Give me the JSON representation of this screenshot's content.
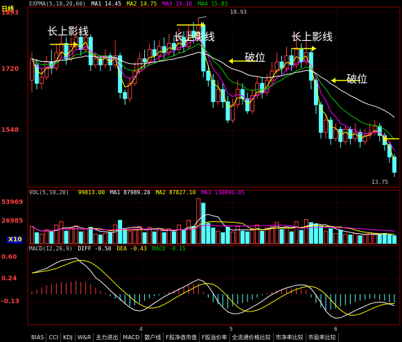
{
  "colors": {
    "up": "#ff3c3c",
    "down": "#54ffff",
    "ma1": "#ffffff",
    "ma2": "#ffff00",
    "ma3": "#ff00ff",
    "ma4": "#00cc00",
    "grid": "#8b0000",
    "axis_text": "#ff4040",
    "highlight": "#ffff00"
  },
  "main_panel": {
    "period": "日线",
    "header": {
      "title": "EXPMA(5,10,20,60)",
      "ma1": "MA1 14.45",
      "ma2": "MA2 14.75",
      "ma3": "MA3 15.16",
      "ma4": "MA4 15.83"
    },
    "y_labels": [
      "1893",
      "1720",
      "1548"
    ],
    "high_label": "18.93",
    "low_label": "13.75",
    "annotations": [
      {
        "text": "长上影线"
      },
      {
        "text": "长上影线"
      },
      {
        "text": "破位"
      },
      {
        "text": "长上影线"
      },
      {
        "text": "破位"
      }
    ]
  },
  "volume_panel": {
    "header": {
      "title": "VOL(5,10,20)",
      "value": "99813.00",
      "ma1": "MA1 87989.20",
      "ma2": "MA2 87827.10",
      "ma3": "MA3 130896.05"
    },
    "y_labels": [
      "53969",
      "26985"
    ],
    "unit_label": "X10"
  },
  "macd_panel": {
    "header": {
      "title": "MACD(12,26,9)",
      "diff": "DIFF -0.50",
      "dea": "DEA -0.43",
      "macd": "MACD -0.15"
    },
    "y_labels": [
      "0.60",
      "0.24",
      "-0.13"
    ]
  },
  "x_ticks": [
    "4",
    "5",
    "6"
  ],
  "tabs": [
    "BIAS",
    "CCI",
    "KDJ",
    "W&R",
    "主力进出",
    "MACD",
    "散户线",
    "F股净值市值",
    "F股溢价率",
    "全流通价格比较",
    "市净率比较",
    "市盈率比较"
  ],
  "chart_data": [
    {
      "type": "candlestick",
      "title": "EXPMA(5,10,20,60)",
      "y_ticks": [
        18.93,
        17.2,
        15.48
      ],
      "ylim": [
        13.5,
        19.2
      ],
      "annotated_high": 18.93,
      "annotated_low": 13.75,
      "candles": [
        [
          16.9,
          17.6,
          17.8,
          16.5
        ],
        [
          17.4,
          16.8,
          17.6,
          16.6
        ],
        [
          16.8,
          17.0,
          17.3,
          16.6
        ],
        [
          17.0,
          17.5,
          17.7,
          16.9
        ],
        [
          17.5,
          17.3,
          17.9,
          17.1
        ],
        [
          17.3,
          17.8,
          18.1,
          17.2
        ],
        [
          17.8,
          18.1,
          18.4,
          17.6
        ],
        [
          18.1,
          17.6,
          18.3,
          17.4
        ],
        [
          17.6,
          18.0,
          18.3,
          17.5
        ],
        [
          18.0,
          18.3,
          18.6,
          17.9
        ],
        [
          18.3,
          17.9,
          18.5,
          17.7
        ],
        [
          17.9,
          18.3,
          18.5,
          17.8
        ],
        [
          18.3,
          17.4,
          18.4,
          17.2
        ],
        [
          17.4,
          17.6,
          17.8,
          17.3
        ],
        [
          17.6,
          17.4,
          17.7,
          17.2
        ],
        [
          17.4,
          17.7,
          17.9,
          17.3
        ],
        [
          17.7,
          17.4,
          17.8,
          17.2
        ],
        [
          17.4,
          17.7,
          18.2,
          17.3
        ],
        [
          17.7,
          16.5,
          17.8,
          16.3
        ],
        [
          16.5,
          16.3,
          16.6,
          16.1
        ],
        [
          16.3,
          16.8,
          17.0,
          16.2
        ],
        [
          16.8,
          17.2,
          17.5,
          16.7
        ],
        [
          17.2,
          17.6,
          17.8,
          17.1
        ],
        [
          17.6,
          17.5,
          17.9,
          17.3
        ],
        [
          17.5,
          17.9,
          18.1,
          17.4
        ],
        [
          17.9,
          17.7,
          18.2,
          17.5
        ],
        [
          17.7,
          18.0,
          18.2,
          17.5
        ],
        [
          18.0,
          17.8,
          18.3,
          17.6
        ],
        [
          17.8,
          18.1,
          18.4,
          17.7
        ],
        [
          18.1,
          17.9,
          18.3,
          17.7
        ],
        [
          17.9,
          18.3,
          18.6,
          17.8
        ],
        [
          18.3,
          18.0,
          18.5,
          17.8
        ],
        [
          18.0,
          18.5,
          18.7,
          17.9
        ],
        [
          18.5,
          18.3,
          18.8,
          18.1
        ],
        [
          18.3,
          18.7,
          18.93,
          18.2
        ],
        [
          18.7,
          17.2,
          18.8,
          17.0
        ],
        [
          17.2,
          16.9,
          17.4,
          16.7
        ],
        [
          16.9,
          16.2,
          17.1,
          16.0
        ],
        [
          16.2,
          16.6,
          16.9,
          16.1
        ],
        [
          16.6,
          16.2,
          16.8,
          16.0
        ],
        [
          16.2,
          15.6,
          16.4,
          15.5
        ],
        [
          15.6,
          16.1,
          16.3,
          15.5
        ],
        [
          16.1,
          16.6,
          16.9,
          16.0
        ],
        [
          16.6,
          16.3,
          16.8,
          16.1
        ],
        [
          16.3,
          15.9,
          16.5,
          15.8
        ],
        [
          15.9,
          16.4,
          16.6,
          15.8
        ],
        [
          16.4,
          16.8,
          17.0,
          16.3
        ],
        [
          16.8,
          16.5,
          17.0,
          16.3
        ],
        [
          16.5,
          16.9,
          17.1,
          16.4
        ],
        [
          16.9,
          17.2,
          17.5,
          16.8
        ],
        [
          17.2,
          17.5,
          17.8,
          17.1
        ],
        [
          17.5,
          17.3,
          17.7,
          17.1
        ],
        [
          17.3,
          17.7,
          18.0,
          17.2
        ],
        [
          17.7,
          17.4,
          17.9,
          17.2
        ],
        [
          17.4,
          17.9,
          18.4,
          17.3
        ],
        [
          17.9,
          17.5,
          18.1,
          17.3
        ],
        [
          17.5,
          17.8,
          18.5,
          17.4
        ],
        [
          17.8,
          16.9,
          17.9,
          16.6
        ],
        [
          16.9,
          16.1,
          17.0,
          15.8
        ],
        [
          16.1,
          15.2,
          16.2,
          15.0
        ],
        [
          15.2,
          15.6,
          15.8,
          15.0
        ],
        [
          15.6,
          15.0,
          15.7,
          14.8
        ],
        [
          15.0,
          15.3,
          15.5,
          14.9
        ],
        [
          15.3,
          14.9,
          15.4,
          14.7
        ],
        [
          14.9,
          15.3,
          15.4,
          14.8
        ],
        [
          15.3,
          15.0,
          15.4,
          14.8
        ],
        [
          15.0,
          15.2,
          15.5,
          14.9
        ],
        [
          15.2,
          14.9,
          15.3,
          14.7
        ],
        [
          14.9,
          15.1,
          15.3,
          14.8
        ],
        [
          15.1,
          15.2,
          15.5,
          15.0
        ],
        [
          15.2,
          15.4,
          15.6,
          15.1
        ],
        [
          15.4,
          15.1,
          15.5,
          14.9
        ],
        [
          15.1,
          14.8,
          15.2,
          14.6
        ],
        [
          14.8,
          14.4,
          14.9,
          14.2
        ],
        [
          14.4,
          13.9,
          14.5,
          13.75
        ]
      ],
      "series": [
        {
          "name": "MA1",
          "color": "#ffffff"
        },
        {
          "name": "MA2",
          "color": "#ffff00"
        },
        {
          "name": "MA3",
          "color": "#ff00ff"
        },
        {
          "name": "MA4",
          "color": "#00cc00"
        }
      ]
    },
    {
      "type": "bar",
      "title": "VOL(5,10,20)",
      "y_ticks": [
        53969,
        26985
      ],
      "ylim": [
        0,
        60000
      ],
      "values": [
        22000,
        14000,
        12000,
        18000,
        15000,
        24000,
        28000,
        16000,
        20000,
        23000,
        15000,
        19000,
        21000,
        12000,
        11000,
        13000,
        14000,
        24000,
        30000,
        17000,
        16000,
        19000,
        22000,
        14000,
        21000,
        15000,
        18000,
        14000,
        19000,
        15000,
        24000,
        17000,
        30000,
        22000,
        58000,
        52000,
        26000,
        20000,
        16000,
        14000,
        21000,
        15000,
        22000,
        16000,
        15000,
        19000,
        24000,
        16000,
        20000,
        22000,
        27000,
        18000,
        21000,
        15000,
        28000,
        17000,
        31000,
        27000,
        25000,
        22000,
        16000,
        19000,
        13000,
        17000,
        12000,
        11000,
        13000,
        10000,
        12000,
        14000,
        11000,
        12000,
        13000,
        11000,
        10000
      ]
    },
    {
      "type": "bar",
      "title": "MACD(12,26,9)",
      "y_ticks": [
        0.6,
        0.24,
        -0.13
      ],
      "ylim": [
        -0.55,
        0.75
      ],
      "values": [
        0.05,
        0.08,
        0.12,
        0.16,
        0.18,
        0.2,
        0.22,
        0.2,
        0.22,
        0.24,
        0.22,
        0.22,
        0.18,
        0.12,
        0.06,
        0.02,
        -0.04,
        -0.08,
        -0.12,
        -0.18,
        -0.22,
        -0.2,
        -0.16,
        -0.12,
        -0.08,
        -0.04,
        -0.02,
        0.02,
        0.04,
        0.06,
        0.1,
        0.12,
        0.16,
        0.18,
        0.2,
        0.04,
        -0.06,
        -0.14,
        -0.18,
        -0.22,
        -0.26,
        -0.22,
        -0.18,
        -0.16,
        -0.14,
        -0.1,
        -0.06,
        -0.02,
        0.02,
        0.04,
        0.06,
        0.08,
        0.1,
        0.1,
        0.12,
        0.1,
        0.08,
        -0.06,
        -0.16,
        -0.24,
        -0.3,
        -0.28,
        -0.26,
        -0.22,
        -0.2,
        -0.18,
        -0.14,
        -0.12,
        -0.1,
        -0.08,
        -0.08,
        -0.1,
        -0.12,
        -0.15,
        -0.15
      ]
    }
  ]
}
